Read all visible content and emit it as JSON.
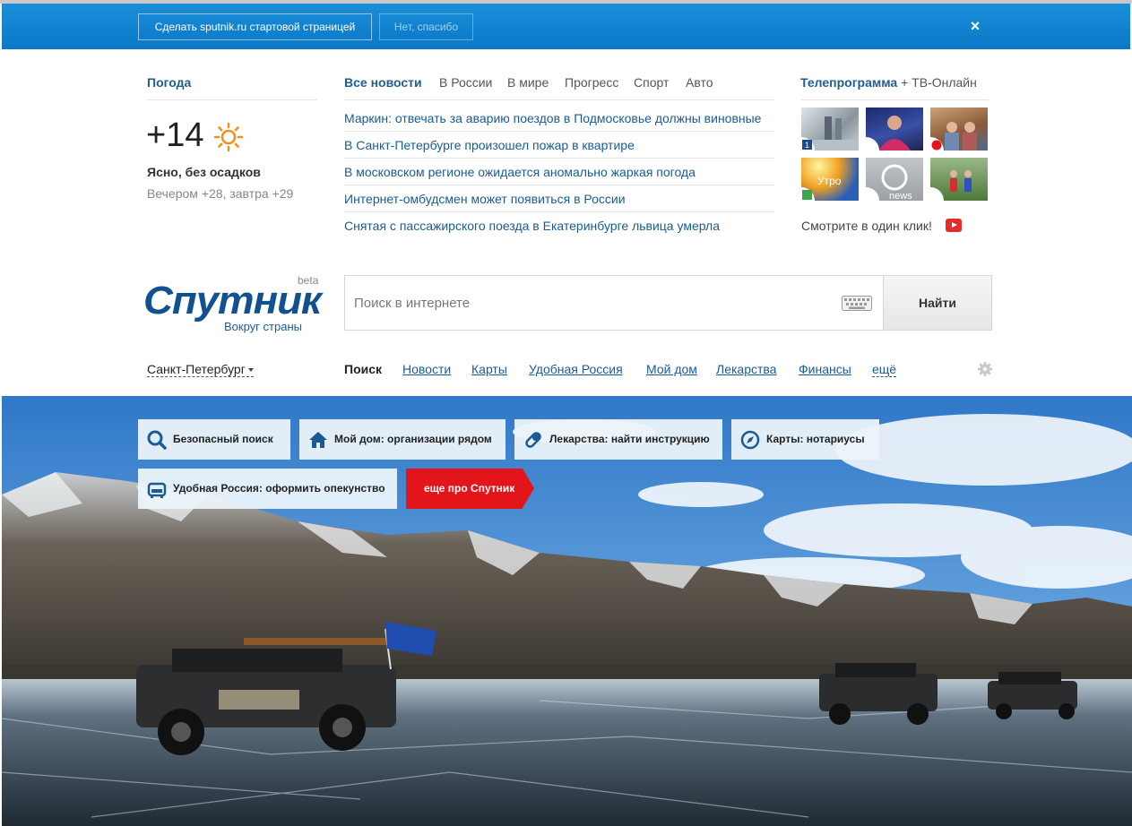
{
  "promo": {
    "make_start": "Сделать sputnik.ru стартовой страницей",
    "no_thanks": "Нет, спасибо",
    "close": "×"
  },
  "weather": {
    "title": "Погода",
    "temp": "+14",
    "desc": "Ясно, без осадков",
    "forecast": "Вечером +28, завтра +29"
  },
  "news": {
    "tabs": [
      "Все новости",
      "В России",
      "В мире",
      "Прогресс",
      "Спорт",
      "Авто"
    ],
    "items": [
      "Маркин: отвечать за аварию поездов в Подмосковье должны виновные",
      "В Санкт-Петербурге произошел пожар в квартире",
      "В московском регионе ожидается аномально жаркая погода",
      "Интернет-омбудсмен может появиться в России",
      "Снятая с пассажирского поезда в Екатеринбурге львица умерла"
    ]
  },
  "tv": {
    "title": "Телепрограмма",
    "online": "+ ТВ-Онлайн",
    "click": "Смотрите в один клик!",
    "thumb_texts": [
      "Утро",
      "news"
    ]
  },
  "logo": {
    "name": "Спутник",
    "beta": "beta",
    "sub": "Вокруг страны"
  },
  "search": {
    "placeholder": "Поиск в интернете",
    "button": "Найти"
  },
  "city": "Санкт-Петербург",
  "services": [
    "Поиск",
    "Новости",
    "Карты",
    "Удобная Россия",
    "Мой дом",
    "Лекарства",
    "Финансы",
    "ещё"
  ],
  "tiles": [
    "Безопасный поиск",
    "Мой дом: организации рядом",
    "Лекарства: найти инструкцию",
    "Карты: нотариусы",
    "Удобная Россия: оформить опекунство"
  ],
  "more_tile": "еще про Спутник",
  "colors": {
    "promo_bar": "#0a78c8",
    "link": "#1a5b96",
    "accent_red": "#e4141b",
    "sun": "#f0901a"
  }
}
